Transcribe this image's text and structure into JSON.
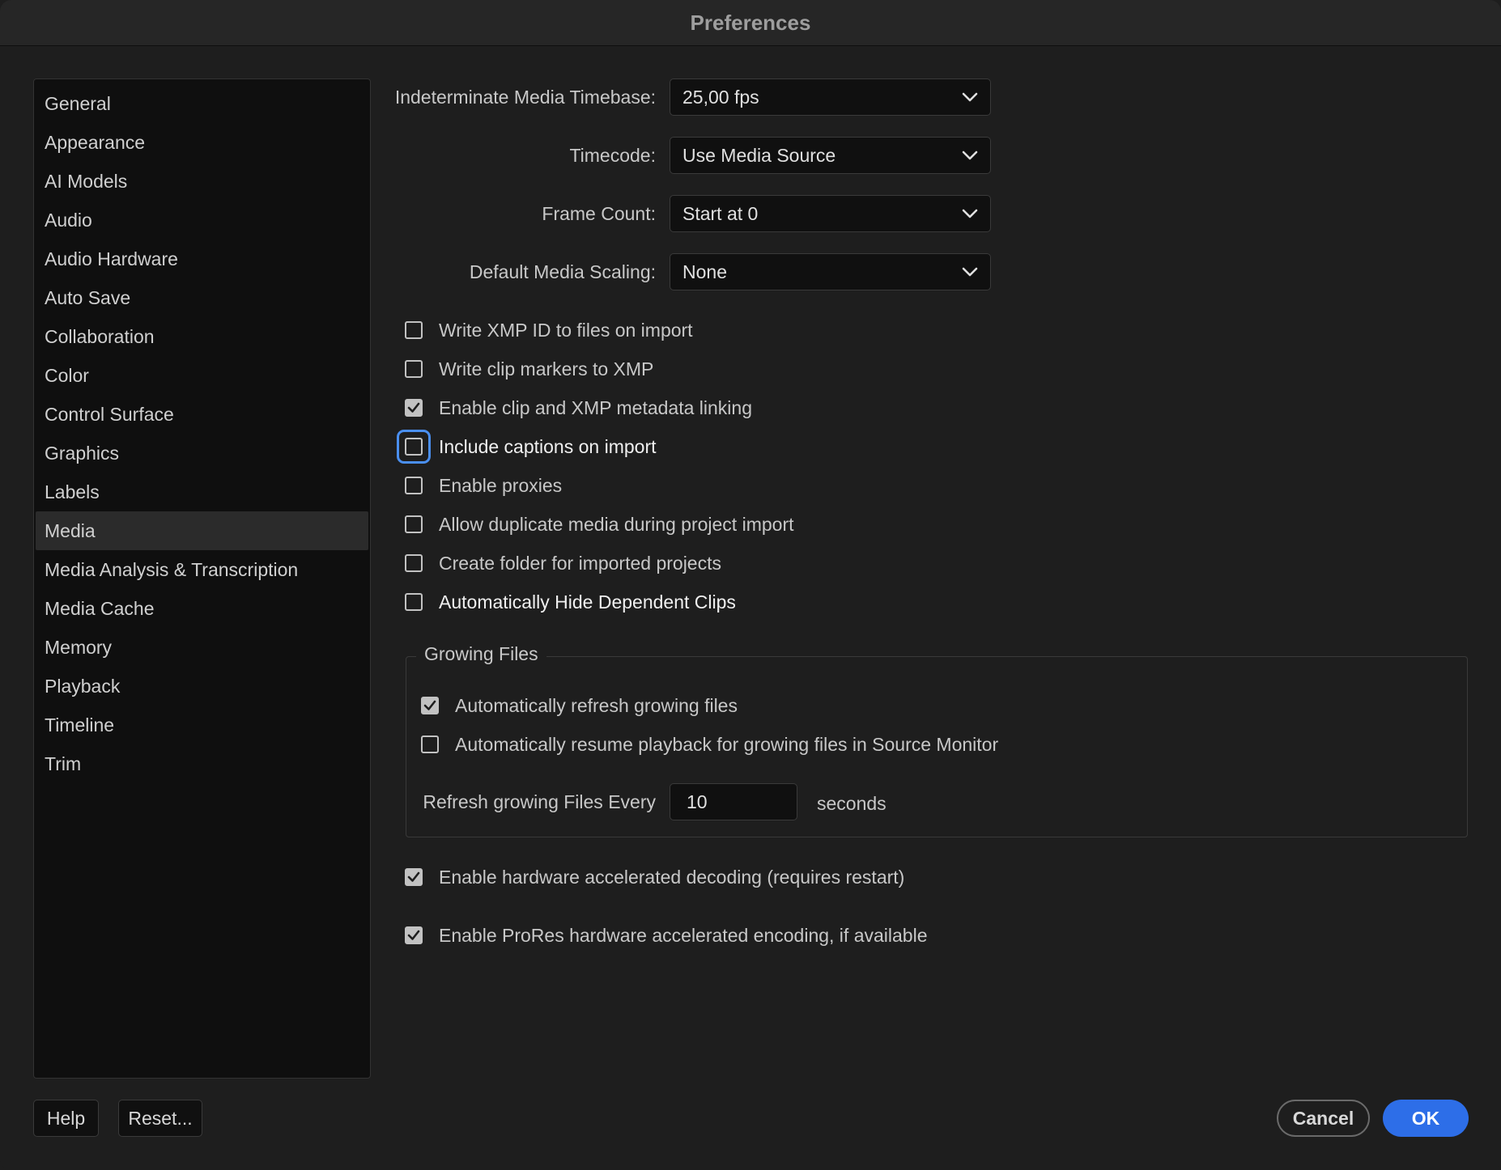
{
  "window": {
    "title": "Preferences"
  },
  "sidebar": {
    "items": [
      {
        "label": "General"
      },
      {
        "label": "Appearance"
      },
      {
        "label": "AI Models"
      },
      {
        "label": "Audio"
      },
      {
        "label": "Audio Hardware"
      },
      {
        "label": "Auto Save"
      },
      {
        "label": "Collaboration"
      },
      {
        "label": "Color"
      },
      {
        "label": "Control Surface"
      },
      {
        "label": "Graphics"
      },
      {
        "label": "Labels"
      },
      {
        "label": "Media"
      },
      {
        "label": "Media Analysis & Transcription"
      },
      {
        "label": "Media Cache"
      },
      {
        "label": "Memory"
      },
      {
        "label": "Playback"
      },
      {
        "label": "Timeline"
      },
      {
        "label": "Trim"
      }
    ],
    "selected": "Media"
  },
  "settings": {
    "timebase": {
      "label": "Indeterminate Media Timebase:",
      "value": "25,00 fps"
    },
    "timecode": {
      "label": "Timecode:",
      "value": "Use Media Source"
    },
    "frame_count": {
      "label": "Frame Count:",
      "value": "Start at 0"
    },
    "scaling": {
      "label": "Default Media Scaling:",
      "value": "None"
    }
  },
  "checkboxes": {
    "xmp_id": {
      "label": "Write XMP ID to files on import",
      "checked": false
    },
    "clip_markers": {
      "label": "Write clip markers to XMP",
      "checked": false
    },
    "metadata_linking": {
      "label": "Enable clip and XMP metadata linking",
      "checked": true
    },
    "captions": {
      "label": "Include captions on import",
      "checked": false
    },
    "proxies": {
      "label": "Enable proxies",
      "checked": false
    },
    "duplicate_media": {
      "label": "Allow duplicate media during project import",
      "checked": false
    },
    "create_folder": {
      "label": "Create folder for imported projects",
      "checked": false
    },
    "hide_dependent": {
      "label": "Automatically Hide Dependent Clips",
      "checked": false
    },
    "hw_decoding": {
      "label": "Enable hardware accelerated decoding (requires restart)",
      "checked": true
    },
    "prores_encoding": {
      "label": "Enable ProRes hardware accelerated encoding, if available",
      "checked": true
    }
  },
  "growing_files": {
    "title": "Growing Files",
    "auto_refresh": {
      "label": "Automatically refresh growing files",
      "checked": true
    },
    "auto_resume": {
      "label": "Automatically resume playback for growing files in Source Monitor",
      "checked": false
    },
    "refresh_label": "Refresh growing Files Every",
    "refresh_value": "10",
    "refresh_unit": "seconds"
  },
  "buttons": {
    "help": "Help",
    "reset": "Reset...",
    "cancel": "Cancel",
    "ok": "OK"
  },
  "colors": {
    "accent": "#2d6ee8",
    "focus_ring": "#4a8ff0",
    "background": "#1e1e1e"
  }
}
